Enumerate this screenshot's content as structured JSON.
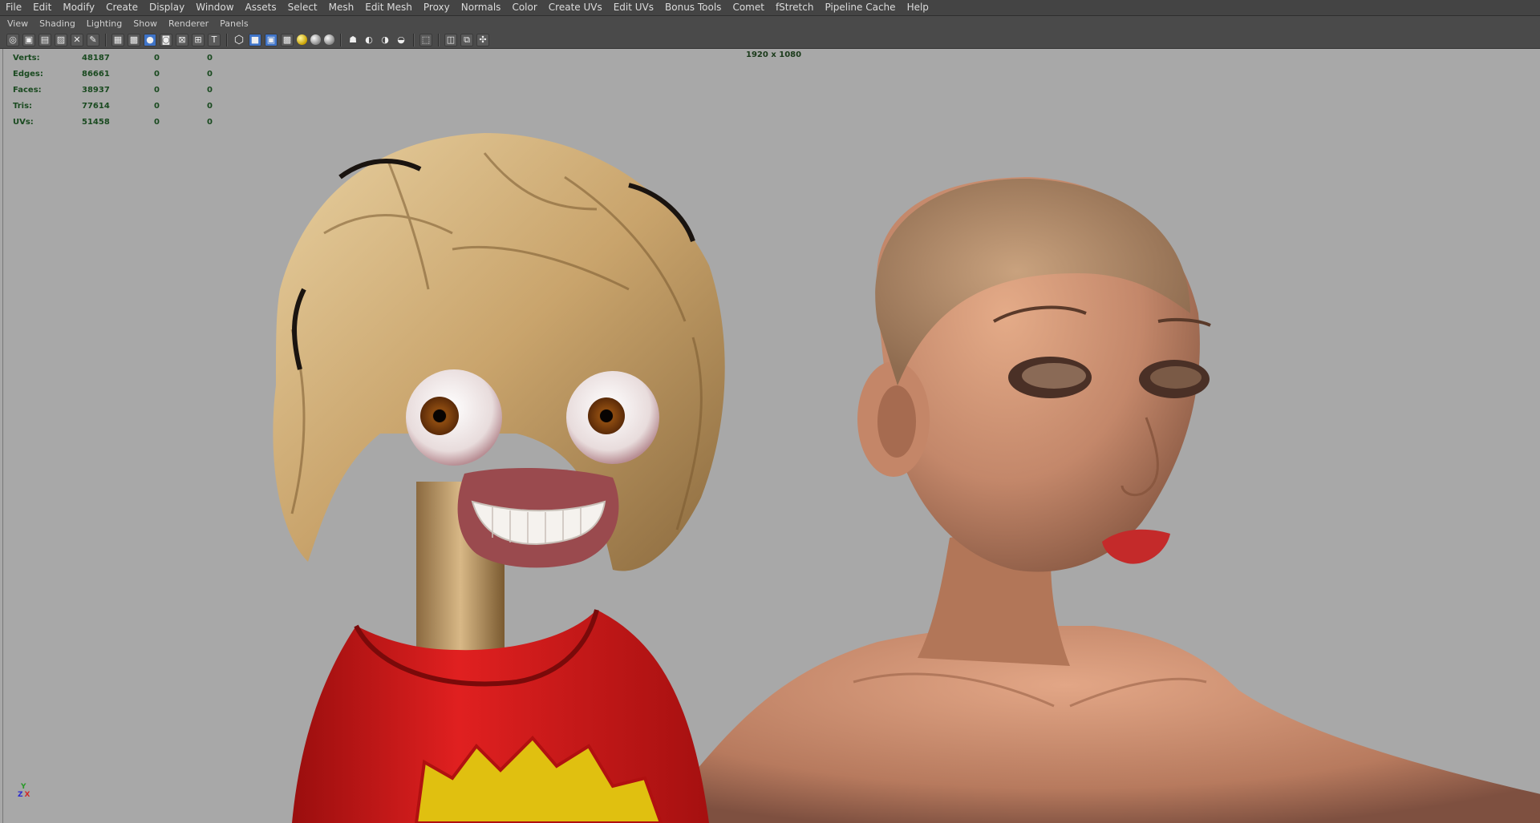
{
  "menubar": [
    "File",
    "Edit",
    "Modify",
    "Create",
    "Display",
    "Window",
    "Assets",
    "Select",
    "Mesh",
    "Edit Mesh",
    "Proxy",
    "Normals",
    "Color",
    "Create UVs",
    "Edit UVs",
    "Bonus Tools",
    "Comet",
    "fStretch",
    "Pipeline Cache",
    "Help"
  ],
  "panel_menu": [
    "View",
    "Shading",
    "Lighting",
    "Show",
    "Renderer",
    "Panels"
  ],
  "toolbar_icons": [
    "camera-icon",
    "camera-attrs-icon",
    "bookmark-icon",
    "image-plane-icon",
    "grid-icon",
    "film-gate-icon",
    "resolution-gate-icon",
    "gate-mask-icon",
    "field-chart-icon",
    "safe-action-icon",
    "safe-title-icon",
    "wireframe-icon",
    "smooth-shade-icon",
    "wireframe-on-shaded-icon",
    "flat-shade-icon",
    "bounding-box-icon",
    "textured-icon",
    "use-all-lights-icon",
    "shadows-icon",
    "default-light-icon",
    "ambient-occlusion-icon",
    "motion-blur-icon",
    "anti-aliasing-icon",
    "depth-of-field-icon",
    "screen-space-reflection-icon",
    "isolate-select-icon",
    "xray-icon",
    "xray-joints-icon",
    "xray-components-icon"
  ],
  "hud": {
    "stats": [
      {
        "label": "Verts:",
        "value": "48187",
        "sel": "0",
        "hl": "0"
      },
      {
        "label": "Edges:",
        "value": "86661",
        "sel": "0",
        "hl": "0"
      },
      {
        "label": "Faces:",
        "value": "38937",
        "sel": "0",
        "hl": "0"
      },
      {
        "label": "Tris:",
        "value": "77614",
        "sel": "0",
        "hl": "0"
      },
      {
        "label": "UVs:",
        "value": "51458",
        "sel": "0",
        "hl": "0"
      }
    ],
    "resolution": "1920 x 1080"
  },
  "axis": {
    "y": "Y",
    "z": "Z",
    "x": "X"
  },
  "colors": {
    "viewport": "#a8a8a8",
    "menubar": "#444444",
    "hud_text": "#1a4a20",
    "shirt_red": "#d81a1a",
    "hair_blonde": "#c9a46c",
    "skin": "#c78a68"
  }
}
